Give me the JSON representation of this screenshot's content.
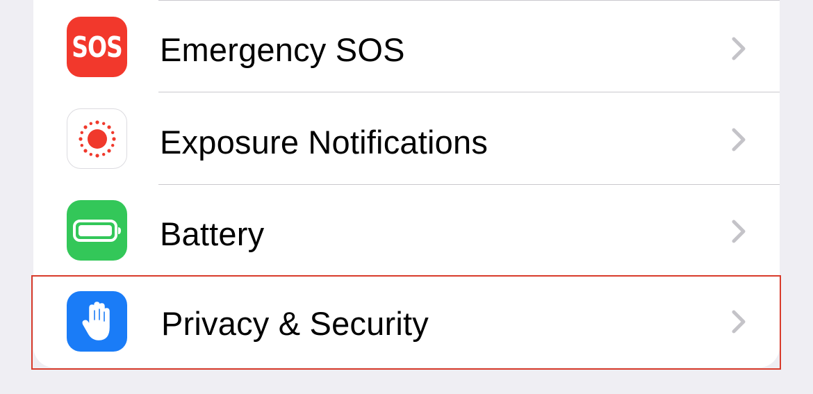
{
  "settings": {
    "items": [
      {
        "label": "Emergency SOS",
        "icon": "sos-icon",
        "icon_text": "SOS",
        "icon_bg": "#f2382c"
      },
      {
        "label": "Exposure Notifications",
        "icon": "exposure-notifications-icon",
        "icon_bg": "#ffffff",
        "icon_accent": "#f0392c"
      },
      {
        "label": "Battery",
        "icon": "battery-icon",
        "icon_bg": "#33c759"
      },
      {
        "label": "Privacy & Security",
        "icon": "hand-icon",
        "icon_bg": "#1a7cf7"
      }
    ],
    "chevron_icon": "chevron-right-icon",
    "highlighted_item": "Privacy & Security",
    "highlight_color": "#d83a2a"
  }
}
